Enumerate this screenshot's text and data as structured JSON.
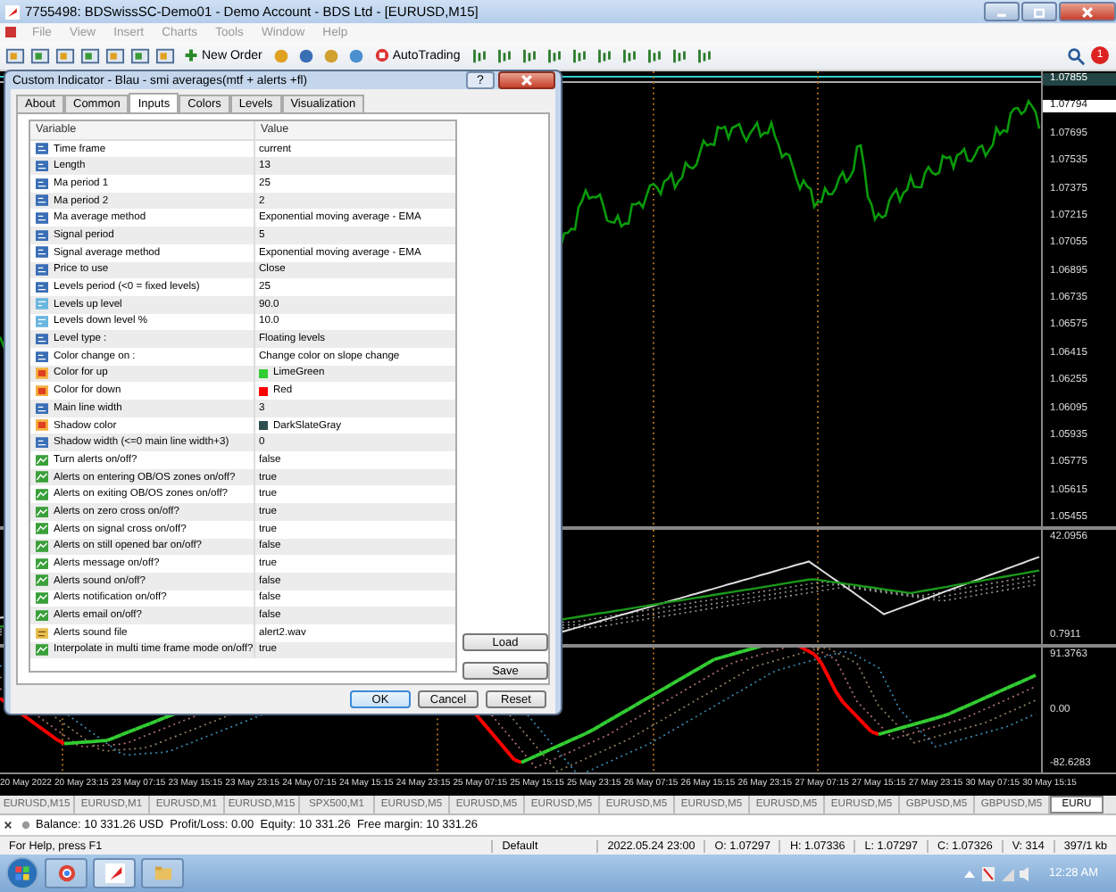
{
  "window": {
    "title": "7755498: BDSwissSC-Demo01 - Demo Account - BDS Ltd - [EURUSD,M15]"
  },
  "menu": [
    {
      "label": "File",
      "disabled": true
    },
    {
      "label": "View",
      "disabled": true
    },
    {
      "label": "Insert",
      "disabled": true
    },
    {
      "label": "Charts",
      "disabled": true
    },
    {
      "label": "Tools",
      "disabled": true
    },
    {
      "label": "Window",
      "disabled": true
    },
    {
      "label": "Help",
      "disabled": true
    }
  ],
  "toolbar": {
    "new_order": "New Order",
    "autotrading": "AutoTrading",
    "notification_count": "1"
  },
  "dialog": {
    "title": "Custom Indicator - Blau - smi averages(mtf + alerts +fl)",
    "help": "?",
    "tabs": [
      {
        "label": "About",
        "selected": false
      },
      {
        "label": "Common",
        "selected": false
      },
      {
        "label": "Inputs",
        "selected": true
      },
      {
        "label": "Colors",
        "selected": false
      },
      {
        "label": "Levels",
        "selected": false
      },
      {
        "label": "Visualization",
        "selected": false
      }
    ],
    "columns": [
      "Variable",
      "Value"
    ],
    "inputs": [
      {
        "variable": "Time frame",
        "value": "current",
        "kind": "number"
      },
      {
        "variable": "Length",
        "value": "13",
        "kind": "number"
      },
      {
        "variable": "Ma period 1",
        "value": "25",
        "kind": "number"
      },
      {
        "variable": "Ma period 2",
        "value": "2",
        "kind": "number"
      },
      {
        "variable": "Ma average method",
        "value": "Exponential moving average - EMA",
        "kind": "number"
      },
      {
        "variable": "Signal period",
        "value": "5",
        "kind": "number"
      },
      {
        "variable": "Signal average method",
        "value": "Exponential moving average - EMA",
        "kind": "number"
      },
      {
        "variable": "Price to use",
        "value": "Close",
        "kind": "number"
      },
      {
        "variable": "Levels period (<0 = fixed levels)",
        "value": "25",
        "kind": "number"
      },
      {
        "variable": "Levels up level",
        "value": "90.0",
        "kind": "decimal"
      },
      {
        "variable": "Levels down level %",
        "value": "10.0",
        "kind": "decimal"
      },
      {
        "variable": "Level type :",
        "value": "Floating levels",
        "kind": "number"
      },
      {
        "variable": "Color change on :",
        "value": "Change color on slope change",
        "kind": "number"
      },
      {
        "variable": "Color for up",
        "value": "LimeGreen",
        "kind": "color",
        "color": "#32cd32"
      },
      {
        "variable": "Color for down",
        "value": "Red",
        "kind": "color",
        "color": "#ff0000"
      },
      {
        "variable": "Main line width",
        "value": "3",
        "kind": "number"
      },
      {
        "variable": "Shadow color",
        "value": "DarkSlateGray",
        "kind": "color",
        "color": "#2f4f4f"
      },
      {
        "variable": "Shadow width (<=0 main line width+3)",
        "value": "0",
        "kind": "number"
      },
      {
        "variable": "Turn alerts on/off?",
        "value": "false",
        "kind": "bool"
      },
      {
        "variable": "Alerts on entering OB/OS zones on/off?",
        "value": "true",
        "kind": "bool"
      },
      {
        "variable": "Alerts on exiting OB/OS zones on/off?",
        "value": "true",
        "kind": "bool"
      },
      {
        "variable": "Alerts on zero cross on/off?",
        "value": "true",
        "kind": "bool"
      },
      {
        "variable": "Alerts on signal cross on/off?",
        "value": "true",
        "kind": "bool"
      },
      {
        "variable": "Alerts on still opened bar on/off?",
        "value": "false",
        "kind": "bool"
      },
      {
        "variable": "Alerts message on/off?",
        "value": "true",
        "kind": "bool"
      },
      {
        "variable": "Alerts sound on/off?",
        "value": "false",
        "kind": "bool"
      },
      {
        "variable": "Alerts notification on/off?",
        "value": "false",
        "kind": "bool"
      },
      {
        "variable": "Alerts email on/off?",
        "value": "false",
        "kind": "bool"
      },
      {
        "variable": "Alerts sound file",
        "value": "alert2.wav",
        "kind": "text"
      },
      {
        "variable": "Interpolate in multi time frame mode on/off?",
        "value": "true",
        "kind": "bool"
      }
    ],
    "side_buttons": [
      "Load",
      "Save"
    ],
    "buttons": [
      {
        "label": "OK",
        "default": true
      },
      {
        "label": "Cancel",
        "default": false
      },
      {
        "label": "Reset",
        "default": false
      }
    ]
  },
  "chart": {
    "price_axis": [
      {
        "label": "1.07855",
        "kind": "ask"
      },
      {
        "label": "1.07794",
        "kind": "bid"
      },
      {
        "label": "1.07695",
        "kind": "tick"
      },
      {
        "label": "1.07535",
        "kind": "tick"
      },
      {
        "label": "1.07375",
        "kind": "tick"
      },
      {
        "label": "1.07215",
        "kind": "tick"
      },
      {
        "label": "1.07055",
        "kind": "tick"
      },
      {
        "label": "1.06895",
        "kind": "tick"
      },
      {
        "label": "1.06735",
        "kind": "tick"
      },
      {
        "label": "1.06575",
        "kind": "tick"
      },
      {
        "label": "1.06415",
        "kind": "tick"
      },
      {
        "label": "1.06255",
        "kind": "tick"
      },
      {
        "label": "1.06095",
        "kind": "tick"
      },
      {
        "label": "1.05935",
        "kind": "tick"
      },
      {
        "label": "1.05775",
        "kind": "tick"
      },
      {
        "label": "1.05615",
        "kind": "tick"
      },
      {
        "label": "1.05455",
        "kind": "tick"
      }
    ],
    "indicator_1_axis": [
      "42.0956",
      "0.7911"
    ],
    "indicator_2_axis": [
      "91.3763",
      "0.00",
      "-82.6283"
    ],
    "time_axis": [
      "20 May 2022",
      "20 May 23:15",
      "23 May 07:15",
      "23 May 15:15",
      "23 May 23:15",
      "24 May 07:15",
      "24 May 15:15",
      "24 May 23:15",
      "25 May 07:15",
      "25 May 15:15",
      "25 May 23:15",
      "26 May 07:15",
      "26 May 15:15",
      "26 May 23:15",
      "27 May 07:15",
      "27 May 15:15",
      "27 May 23:15",
      "30 May 07:15",
      "30 May 15:15"
    ]
  },
  "symbol_tabs": [
    {
      "label": "EURUSD,M15",
      "selected": false
    },
    {
      "label": "EURUSD,M1",
      "selected": false
    },
    {
      "label": "EURUSD,M1",
      "selected": false
    },
    {
      "label": "EURUSD,M15",
      "selected": false
    },
    {
      "label": "SPX500,M1",
      "selected": false
    },
    {
      "label": "EURUSD,M5",
      "selected": false
    },
    {
      "label": "EURUSD,M5",
      "selected": false
    },
    {
      "label": "EURUSD,M5",
      "selected": false
    },
    {
      "label": "EURUSD,M5",
      "selected": false
    },
    {
      "label": "EURUSD,M5",
      "selected": false
    },
    {
      "label": "EURUSD,M5",
      "selected": false
    },
    {
      "label": "EURUSD,M5",
      "selected": false
    },
    {
      "label": "GBPUSD,M5",
      "selected": false
    },
    {
      "label": "GBPUSD,M5",
      "selected": false
    },
    {
      "label": "EURU",
      "selected": true
    }
  ],
  "terminal": {
    "summary": "Balance: 10 331.26 USD  Profit/Loss: 0.00  Equity: 10 331.26  Free margin: 10 331.26"
  },
  "status_bar": [
    "For Help, press F1",
    "Default",
    "2022.05.24 23:00",
    "O: 1.07297",
    "H: 1.07336",
    "L: 1.07297",
    "C: 1.07326",
    "V: 314",
    "397/1 kb"
  ],
  "taskbar": {
    "clock": "12:28 AM"
  }
}
